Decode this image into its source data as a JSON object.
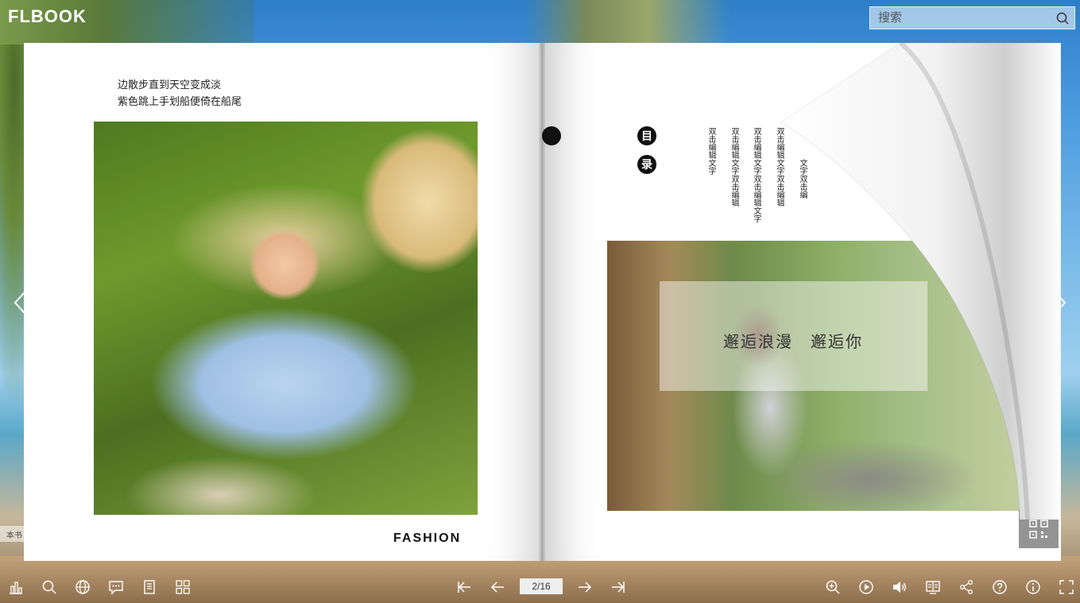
{
  "app": {
    "logo": "FLBOOK"
  },
  "search": {
    "placeholder": "搜索"
  },
  "left_page": {
    "poem_line1": "边散步直到天空变成淡",
    "poem_line2": "紫色跳上手划船便倚在船尾",
    "footer": "FASHION"
  },
  "right_page": {
    "toc_char1": "目",
    "toc_char2": "录",
    "toc_columns": [
      "双击编辑文字",
      "双击编辑文字双击编辑",
      "双击编辑文字双击编辑文字",
      "双击编辑文字双击编辑",
      "文字双击编"
    ],
    "overlay_text": "邂逅浪漫　邂逅你"
  },
  "corner_label": "本书",
  "toolbar": {
    "page_indicator": "2/16"
  },
  "icons": {
    "left": [
      "bar-chart-icon",
      "search-icon",
      "globe-icon",
      "comment-icon",
      "document-icon",
      "grid-icon"
    ],
    "center": [
      "first-page-icon",
      "prev-page-icon",
      "next-page-icon",
      "last-page-icon"
    ],
    "right": [
      "zoom-in-icon",
      "play-icon",
      "volume-icon",
      "bookshelf-icon",
      "share-icon",
      "help-icon",
      "info-icon",
      "fullscreen-icon"
    ]
  }
}
